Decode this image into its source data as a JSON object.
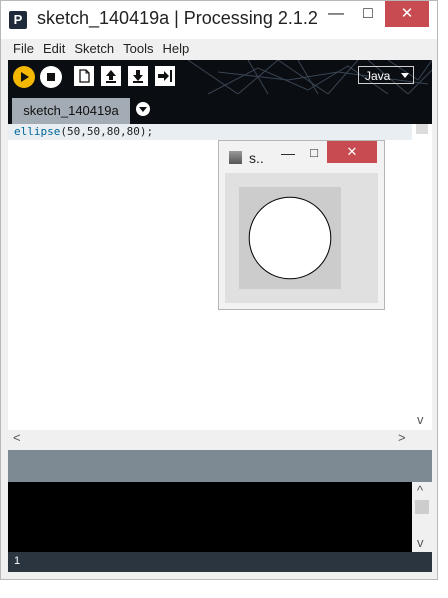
{
  "window": {
    "app_icon_letter": "P",
    "title": "sketch_140419a | Processing 2.1.2",
    "minimize_glyph": "—",
    "maximize_glyph": "□",
    "close_glyph": "✕"
  },
  "menu": [
    "File",
    "Edit",
    "Sketch",
    "Tools",
    "Help"
  ],
  "toolbar": {
    "buttons": [
      "run-icon",
      "stop-icon",
      "new-icon",
      "open-icon",
      "save-icon",
      "export-icon"
    ],
    "mode": "Java"
  },
  "tabs": [
    {
      "label": "sketch_140419a",
      "active": true
    }
  ],
  "editor": {
    "code_lines": [
      {
        "fn": "ellipse",
        "rest": "(50,50,80,80);"
      }
    ],
    "scroll_up": "^",
    "scroll_down": "v",
    "scroll_left": "<",
    "scroll_right": ">"
  },
  "console": {
    "scroll_up": "^",
    "scroll_down": "v"
  },
  "status": {
    "line_number": "1"
  },
  "sketch_window": {
    "title": "s..",
    "minimize_glyph": "—",
    "maximize_glyph": "□",
    "close_glyph": "✕",
    "canvas_bg": "#cccccc",
    "ellipse_fill": "#ffffff",
    "ellipse_stroke": "#000000"
  },
  "colors": {
    "run": "#f5b800",
    "toolbar_bg": "#0a0d12",
    "tab_active": "#a3acb4",
    "close_red": "#c74b50",
    "console_bg": "#000000",
    "message_bar": "#7e8a93"
  }
}
